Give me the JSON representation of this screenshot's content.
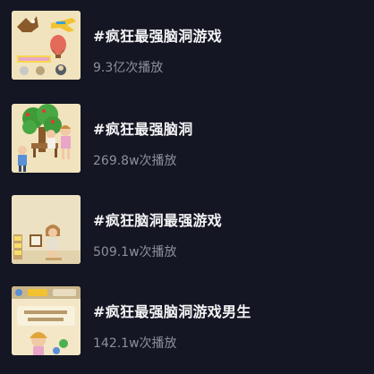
{
  "topics": [
    {
      "title": "#疯狂最强脑洞游戏",
      "play_count": "9.3亿次播放"
    },
    {
      "title": "#疯狂最强脑洞",
      "play_count": "269.8w次播放"
    },
    {
      "title": "#疯狂脑洞最强游戏",
      "play_count": "509.1w次播放"
    },
    {
      "title": "#疯狂最强脑洞游戏男生",
      "play_count": "142.1w次播放"
    }
  ],
  "colors": {
    "background": "#151623",
    "title_text": "#f4f4f6",
    "count_text": "#8d8f9b"
  }
}
